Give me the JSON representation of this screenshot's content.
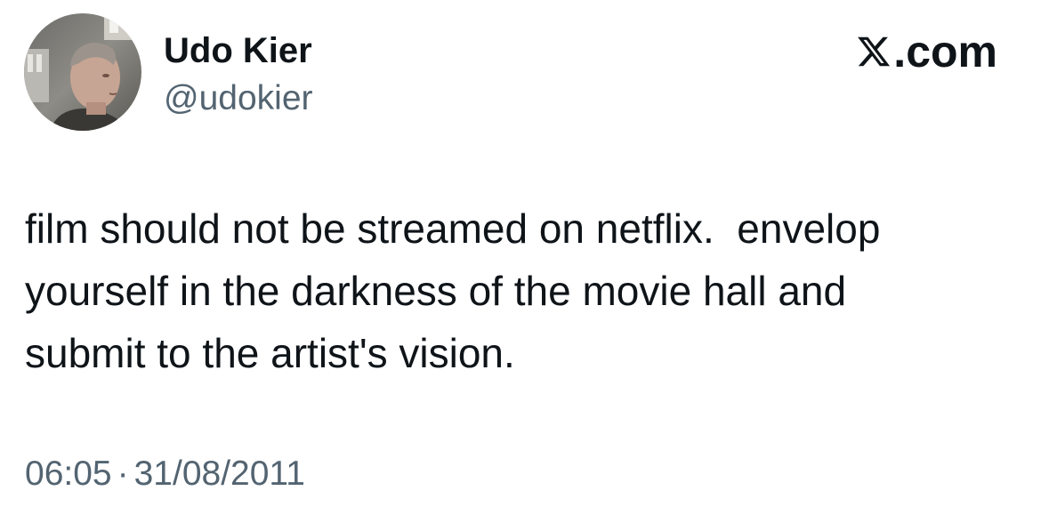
{
  "author": {
    "display_name": "Udo Kier",
    "handle": "@udokier",
    "avatar_icon": "profile-photo"
  },
  "brand": {
    "icon": "x-logo-icon",
    "suffix": ".com"
  },
  "tweet": {
    "text": "film should not be streamed on netflix.  envelop\nyourself in the darkness of the movie hall and\nsubmit to the artist's vision."
  },
  "meta": {
    "time": "06:05",
    "separator": "·",
    "date": "31/08/2011"
  },
  "colors": {
    "text_primary": "#0f1419",
    "text_secondary": "#536471",
    "background": "#ffffff"
  }
}
